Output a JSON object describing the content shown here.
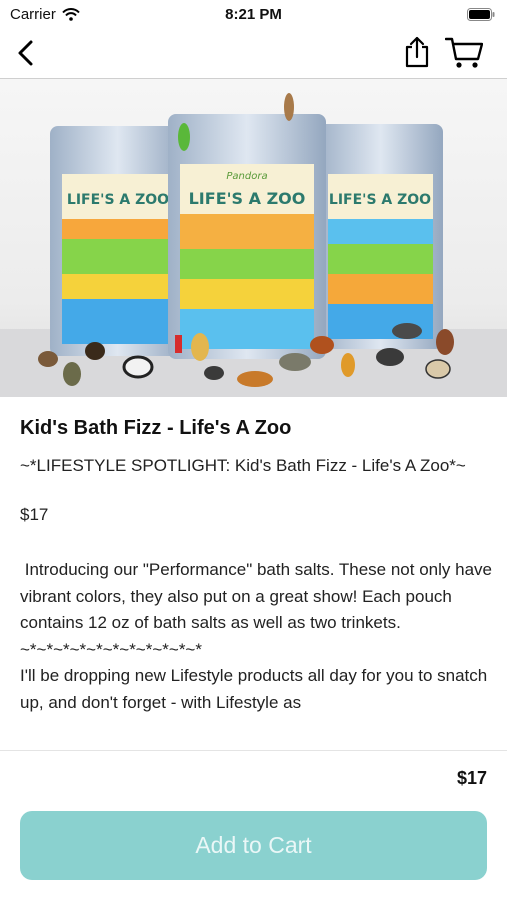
{
  "status_bar": {
    "carrier": "Carrier",
    "time": "8:21 PM"
  },
  "hero": {
    "label": "LIFE'S A ZOO",
    "brand": "Pandora"
  },
  "product": {
    "title": "Kid's Bath Fizz - Life's A Zoo",
    "subtitle": "~*LIFESTYLE SPOTLIGHT: Kid's Bath Fizz - Life's A Zoo*~",
    "price": "$17",
    "description": " Introducing our \"Performance\" bath salts. These not only have vibrant colors, they also put on a great show! Each pouch contains 12 oz of bath salts as well as two trinkets.\n~*~*~*~*~*~*~*~*~*~*~*\nI'll be dropping new Lifestyle products all day for you to snatch up, and don't forget - with Lifestyle as"
  },
  "bottom_bar": {
    "price": "$17",
    "add_to_cart_label": "Add to Cart"
  },
  "colors": {
    "accent": "#8ad1cf",
    "accent_text": "#eaf7f7"
  },
  "icons": [
    "wifi-icon",
    "battery-icon",
    "back-chevron-icon",
    "share-icon",
    "cart-icon"
  ]
}
